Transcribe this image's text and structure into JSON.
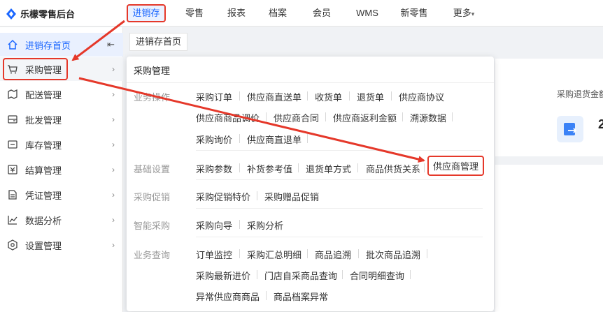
{
  "brand": {
    "title": "乐檬零售后台",
    "logo_icon": "brand-logo-icon"
  },
  "topnav": {
    "items": [
      "进销存",
      "零售",
      "报表",
      "档案",
      "会员",
      "WMS",
      "新零售",
      "更多"
    ],
    "more_caret": "▾",
    "active_index": 0
  },
  "sidebar": {
    "home": "进销存首页",
    "collapse_icon": "⇤",
    "items": [
      "采购管理",
      "配送管理",
      "批发管理",
      "库存管理",
      "结算管理",
      "凭证管理",
      "数据分析",
      "设置管理"
    ],
    "chevron": "›"
  },
  "tabs": [
    "进销存首页"
  ],
  "background": {
    "card_title": "采购退货金额",
    "card_value": "2"
  },
  "menu": {
    "title": "采购管理",
    "sections": [
      {
        "label": "业务操作",
        "rows": [
          [
            "采购订单",
            "供应商直送单",
            "收货单",
            "退货单",
            "供应商协议"
          ],
          [
            "供应商商品调价",
            "供应商合同",
            "供应商返利金额",
            "溯源数据"
          ],
          [
            "采购询价",
            "供应商直退单"
          ]
        ]
      },
      {
        "label": "基础设置",
        "rows": [
          [
            "采购参数",
            "补货参考值",
            "退货单方式",
            "商品供货关系",
            "供应商管理"
          ]
        ]
      },
      {
        "label": "采购促销",
        "rows": [
          [
            "采购促销特价",
            "采购赠品促销"
          ]
        ]
      },
      {
        "label": "智能采购",
        "rows": [
          [
            "采购向导",
            "采购分析"
          ]
        ]
      },
      {
        "label": "业务查询",
        "rows": [
          [
            "订单监控",
            "采购汇总明细",
            "商品追溯",
            "批次商品追溯"
          ],
          [
            "采购最新进价",
            "门店自采商品查询",
            "合同明细查询"
          ],
          [
            "异常供应商商品",
            "商品档案异常"
          ]
        ]
      }
    ]
  },
  "colors": {
    "accent": "#1a66ff",
    "highlight": "#e5382a"
  }
}
